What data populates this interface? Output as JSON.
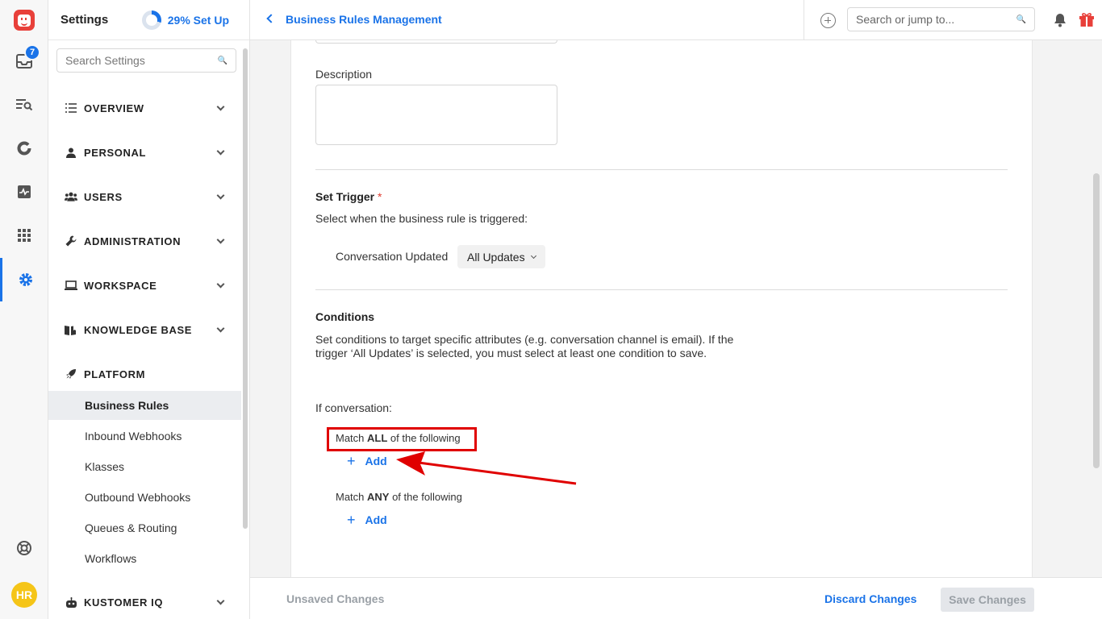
{
  "rail": {
    "inbox_badge": "7",
    "avatar_initials": "HR",
    "accent": "#1a73e8",
    "brand": "#e8403a"
  },
  "sidebar": {
    "title": "Settings",
    "setup_label": "29% Set Up",
    "setup_percent": 29,
    "search_placeholder": "Search Settings",
    "sections": [
      {
        "label": "OVERVIEW",
        "icon": "list-icon"
      },
      {
        "label": "PERSONAL",
        "icon": "person-icon"
      },
      {
        "label": "USERS",
        "icon": "users-icon"
      },
      {
        "label": "ADMINISTRATION",
        "icon": "wrench-icon"
      },
      {
        "label": "WORKSPACE",
        "icon": "laptop-icon"
      },
      {
        "label": "KNOWLEDGE BASE",
        "icon": "book-icon"
      },
      {
        "label": "PLATFORM",
        "icon": "rocket-icon"
      },
      {
        "label": "KUSTOMER IQ",
        "icon": "robot-icon"
      }
    ],
    "platform_items": [
      "Business Rules",
      "Inbound Webhooks",
      "Klasses",
      "Outbound Webhooks",
      "Queues & Routing",
      "Workflows"
    ]
  },
  "topbar": {
    "breadcrumb": "Business Rules Management",
    "search_placeholder": "Search or jump to..."
  },
  "form": {
    "description_label": "Description",
    "trigger_title": "Set Trigger",
    "trigger_required": "*",
    "trigger_help": "Select when the business rule is triggered:",
    "trigger_event": "Conversation Updated",
    "trigger_option": "All Updates",
    "conditions_title": "Conditions",
    "conditions_help": "Set conditions to target specific attributes (e.g. conversation channel is email). If the trigger ‘All Updates’ is selected, you must select at least one condition to save.",
    "if_label": "If conversation:",
    "match_all_prefix": "Match ",
    "match_all_bold": "ALL",
    "match_all_suffix": " of the following",
    "match_any_prefix": "Match ",
    "match_any_bold": "ANY",
    "match_any_suffix": " of the following",
    "add_label": "Add",
    "add_symbol": "+"
  },
  "footer": {
    "status": "Unsaved Changes",
    "discard": "Discard Changes",
    "save": "Save Changes"
  }
}
